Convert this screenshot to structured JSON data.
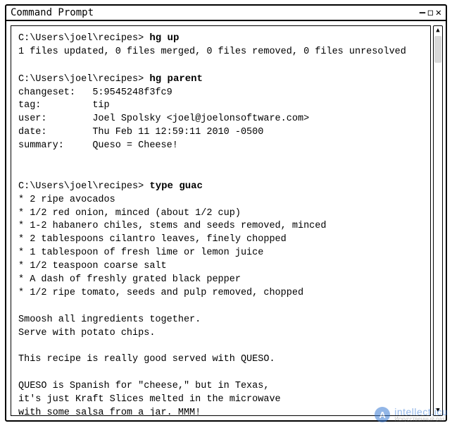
{
  "window": {
    "title": "Command Prompt",
    "controls": {
      "min": "—",
      "restore": "◻",
      "close": "✕"
    }
  },
  "terminal": {
    "prompt": "C:\\Users\\joel\\recipes>",
    "blocks": [
      {
        "cmd": "hg up",
        "output": [
          "1 files updated, 0 files merged, 0 files removed, 0 files unresolved"
        ]
      },
      {
        "cmd": "hg parent",
        "output": [
          "changeset:   5:9545248f3fc9",
          "tag:         tip",
          "user:        Joel Spolsky <joel@joelonsoftware.com>",
          "date:        Thu Feb 11 12:59:11 2010 -0500",
          "summary:     Queso = Cheese!"
        ]
      },
      {
        "cmd": "type guac",
        "output": [
          "* 2 ripe avocados",
          "* 1/2 red onion, minced (about 1/2 cup)",
          "* 1-2 habanero chiles, stems and seeds removed, minced",
          "* 2 tablespoons cilantro leaves, finely chopped",
          "* 1 tablespoon of fresh lime or lemon juice",
          "* 1/2 teaspoon coarse salt",
          "* A dash of freshly grated black pepper",
          "* 1/2 ripe tomato, seeds and pulp removed, chopped",
          "",
          "Smoosh all ingredients together.",
          "Serve with potato chips.",
          "",
          "This recipe is really good served with QUESO.",
          "",
          "QUESO is Spanish for \"cheese,\" but in Texas,",
          "it's just Kraft Slices melted in the microwave",
          "with some salsa from a jar. MMM!"
        ]
      }
    ]
  },
  "scrollbar": {
    "up": "▲",
    "down": "▼"
  },
  "watermark": {
    "badge": "A",
    "main": "intellect.icu",
    "sub": "Искусственный раз"
  }
}
